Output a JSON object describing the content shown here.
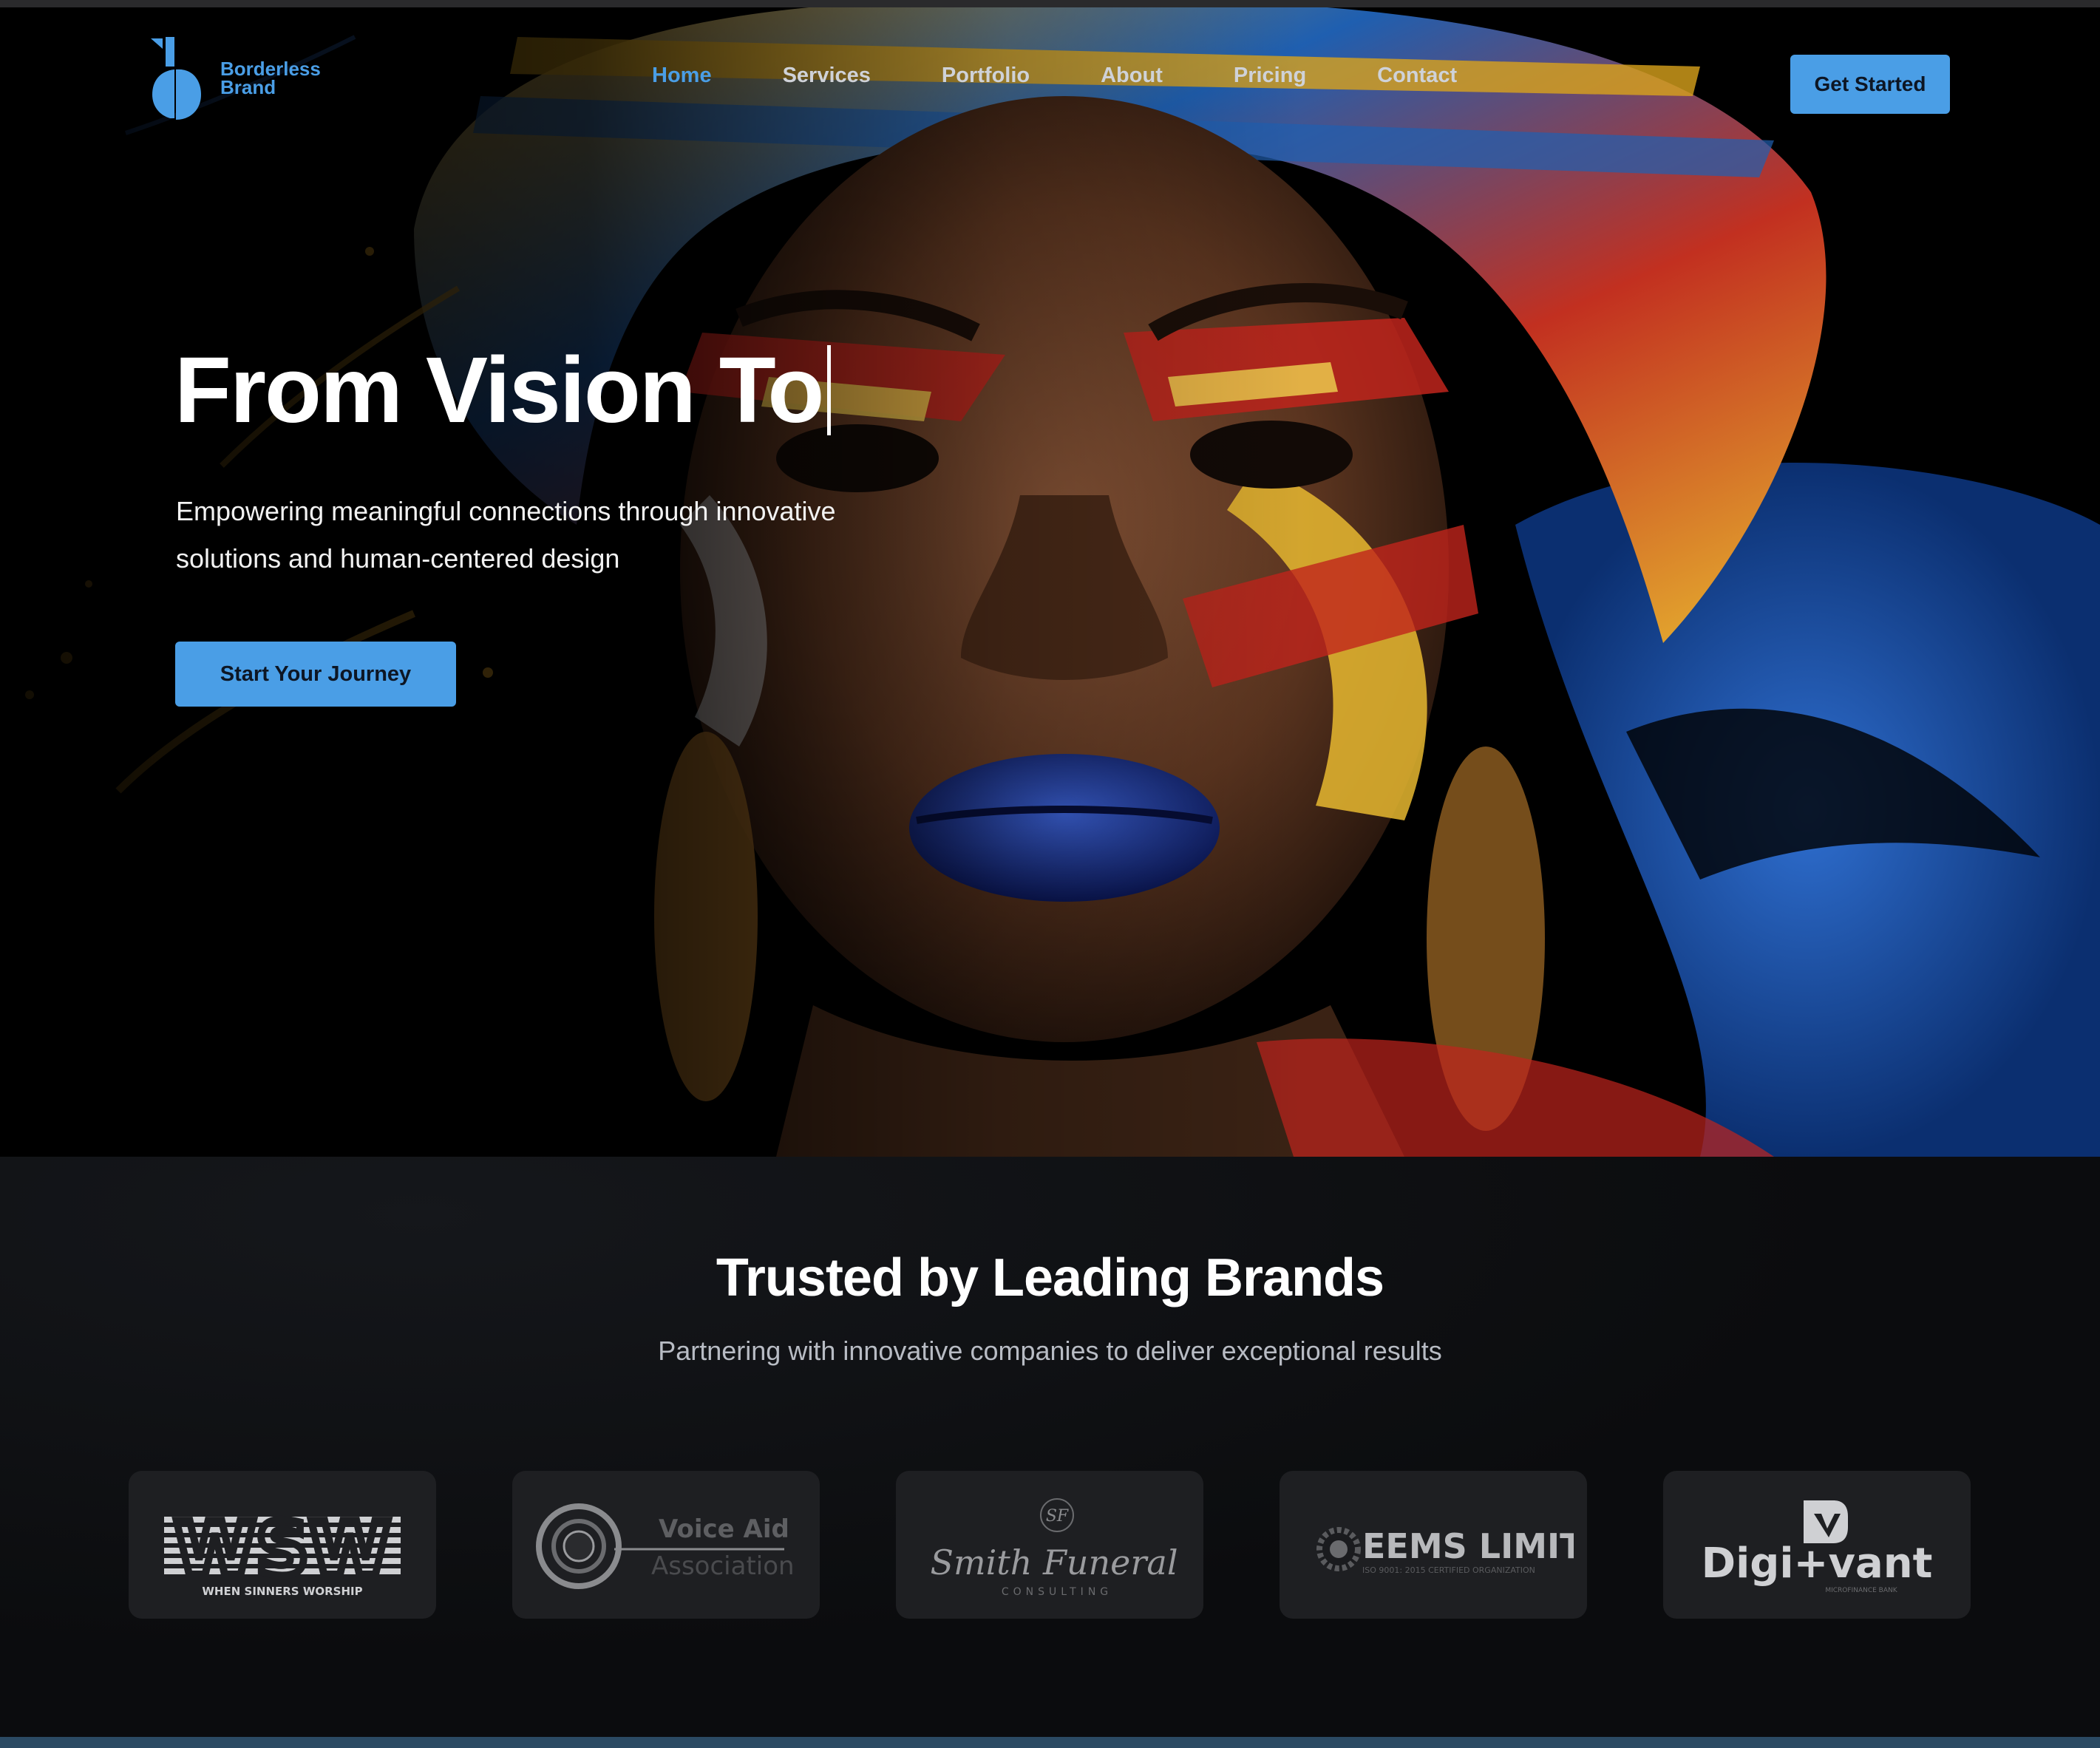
{
  "nav": {
    "logo_text_1": "Borderless",
    "logo_text_2": "Brand",
    "links": [
      {
        "label": "Home",
        "active": true
      },
      {
        "label": "Services"
      },
      {
        "label": "Portfolio"
      },
      {
        "label": "About"
      },
      {
        "label": "Pricing"
      },
      {
        "label": "Contact"
      }
    ],
    "cta_label": "Get Started"
  },
  "hero": {
    "title": "From Vision To",
    "subtitle_line_1": "Empowering meaningful connections through innovative",
    "subtitle_line_2": "solutions and human-centered design",
    "cta_label": "Start Your Journey"
  },
  "trusted": {
    "title": "Trusted by Leading Brands",
    "subtitle": "Partnering with innovative companies to deliver exceptional results",
    "brands": [
      {
        "name": "WSW",
        "tagline": "WHEN SINNERS WORSHIP"
      },
      {
        "name_1": "Voice Aid",
        "name_2": "Association"
      },
      {
        "name": "Smith Funeral",
        "tagline": "CONSULTING",
        "monogram": "SF"
      },
      {
        "name": "EEMS LIMITED",
        "tagline": "ISO 9001: 2015 CERTIFIED ORGANIZATION"
      },
      {
        "name": "Digi+vant",
        "tagline": "MICROFINANCE BANK"
      }
    ]
  },
  "colors": {
    "accent": "#4a9ee6",
    "background": "#0b0c0e",
    "card": "#1e1f22"
  }
}
